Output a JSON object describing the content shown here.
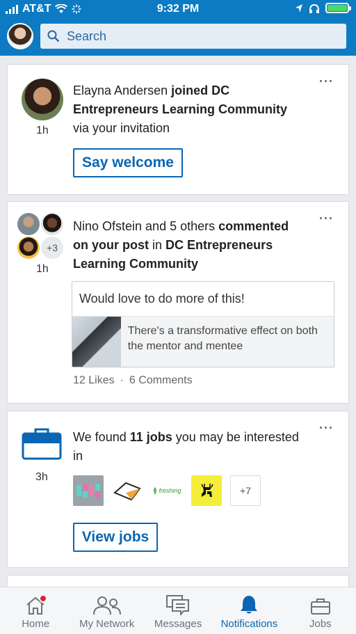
{
  "status_bar": {
    "carrier": "AT&T",
    "time": "9:32 PM"
  },
  "header": {
    "search_placeholder": "Search"
  },
  "notifications": [
    {
      "actor": "Elayna Andersen",
      "action": "joined DC Entrepreneurs Learning Community",
      "suffix": "via your invitation",
      "time": "1h",
      "button_label": "Say welcome"
    },
    {
      "actor": "Nino Ofstein and 5 others",
      "action": "commented on your post",
      "connector": "in",
      "group": "DC Entrepreneurs Learning Community",
      "extra_count": "+3",
      "time": "1h",
      "quote": "Would love to do more of this!",
      "link_title": "There's a transformative effect on both the mentor and mentee",
      "likes": "12 Likes",
      "separator": "·",
      "comments": "6 Comments"
    },
    {
      "prefix": "We found",
      "count": "11 jobs",
      "suffix": "you may be interested in",
      "time": "3h",
      "logo_freshing": "freshing",
      "more_logos": "+7",
      "button_label": "View jobs"
    }
  ],
  "bottom_nav": [
    {
      "label": "Home"
    },
    {
      "label": "My Network"
    },
    {
      "label": "Messages"
    },
    {
      "label": "Notifications"
    },
    {
      "label": "Jobs"
    }
  ],
  "colors": {
    "brand": "#0c7bc3",
    "accent": "#0a66b2",
    "badge": "#e0242c"
  }
}
